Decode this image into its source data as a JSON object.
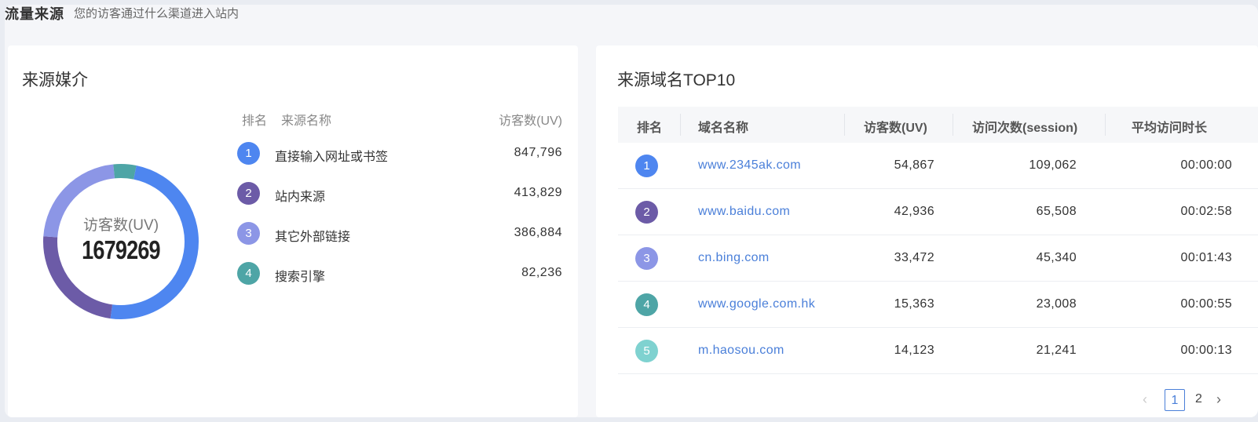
{
  "header": {
    "title": "流量来源",
    "subtitle": "您的访客通过什么渠道进入站内"
  },
  "media_card": {
    "title": "来源媒介",
    "columns": {
      "rank": "排名",
      "name": "来源名称",
      "uv": "访客数(UV)"
    },
    "donut": {
      "label": "访客数(UV)",
      "total": "1679269"
    },
    "rows": [
      {
        "rank": "1",
        "name": "直接输入网址或书签",
        "uv": "847,796"
      },
      {
        "rank": "2",
        "name": "站内来源",
        "uv": "413,829"
      },
      {
        "rank": "3",
        "name": "其它外部链接",
        "uv": "386,884"
      },
      {
        "rank": "4",
        "name": "搜索引擎",
        "uv": "82,236"
      }
    ]
  },
  "chart_data": {
    "type": "pie",
    "categories": [
      "直接输入网址或书签",
      "站内来源",
      "其它外部链接",
      "搜索引擎"
    ],
    "values": [
      847796,
      413829,
      386884,
      82236
    ],
    "colors": [
      "#4e86f0",
      "#6c5ba7",
      "#8c96e6",
      "#4ea5a6"
    ]
  },
  "domain_card": {
    "title": "来源域名TOP10",
    "columns": {
      "rank": "排名",
      "domain": "域名名称",
      "uv": "访客数(UV)",
      "sessions": "访问次数(session)",
      "duration": "平均访问时长"
    },
    "rows": [
      {
        "rank": "1",
        "domain": "www.2345ak.com",
        "uv": "54,867",
        "sessions": "109,062",
        "duration": "00:00:00"
      },
      {
        "rank": "2",
        "domain": "www.baidu.com",
        "uv": "42,936",
        "sessions": "65,508",
        "duration": "00:02:58"
      },
      {
        "rank": "3",
        "domain": "cn.bing.com",
        "uv": "33,472",
        "sessions": "45,340",
        "duration": "00:01:43"
      },
      {
        "rank": "4",
        "domain": "www.google.com.hk",
        "uv": "15,363",
        "sessions": "23,008",
        "duration": "00:00:55"
      },
      {
        "rank": "5",
        "domain": "m.haosou.com",
        "uv": "14,123",
        "sessions": "21,241",
        "duration": "00:00:13"
      }
    ],
    "pagination": {
      "prev": "‹",
      "pages": [
        "1",
        "2"
      ],
      "current": "1",
      "next": "›"
    }
  },
  "rank_colors": [
    "#4e86f0",
    "#6c5ba7",
    "#8c96e6",
    "#4ea5a6",
    "#7fd2d0"
  ]
}
